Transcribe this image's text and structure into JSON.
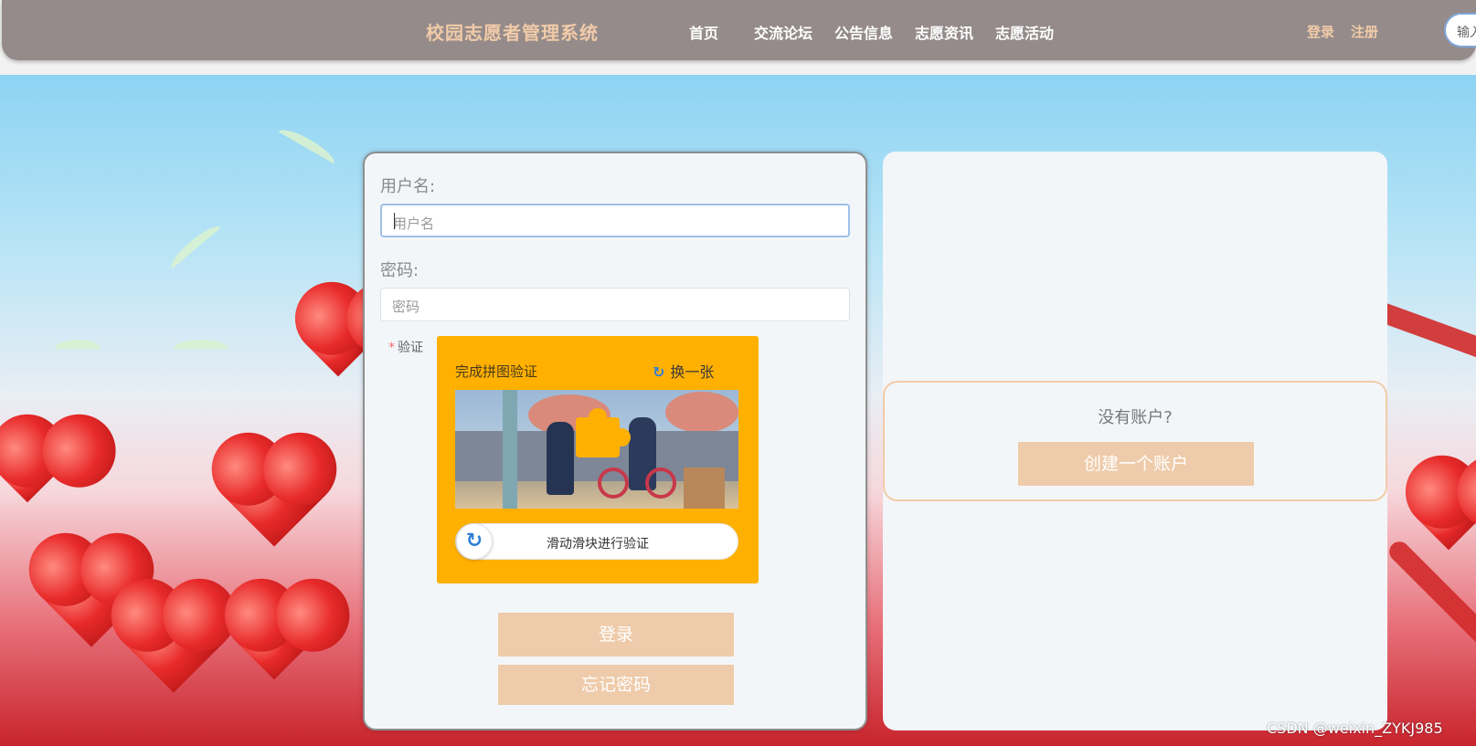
{
  "header": {
    "site_title": "校园志愿者管理系统",
    "nav": [
      "首页",
      "交流论坛",
      "公告信息",
      "志愿资讯",
      "志愿活动"
    ],
    "login_link": "登录",
    "register_link": "注册",
    "search_placeholder": "输入"
  },
  "login_form": {
    "username_label": "用户名:",
    "username_placeholder": "用户名",
    "password_label": "密码:",
    "password_placeholder": "密码",
    "verify_label": "验证",
    "captcha_title": "完成拼图验证",
    "captcha_refresh": "换一张",
    "slider_text": "滑动滑块进行验证",
    "login_button": "登录",
    "forgot_button": "忘记密码"
  },
  "signup_panel": {
    "question": "没有账户?",
    "create_button": "创建一个账户"
  },
  "watermark": "CSDN @weixin_ZYKJ985",
  "colors": {
    "topbar": "#958b8b",
    "accent": "#f1cba8",
    "button": "#eecbaa",
    "captcha_bg": "#ffb000"
  }
}
